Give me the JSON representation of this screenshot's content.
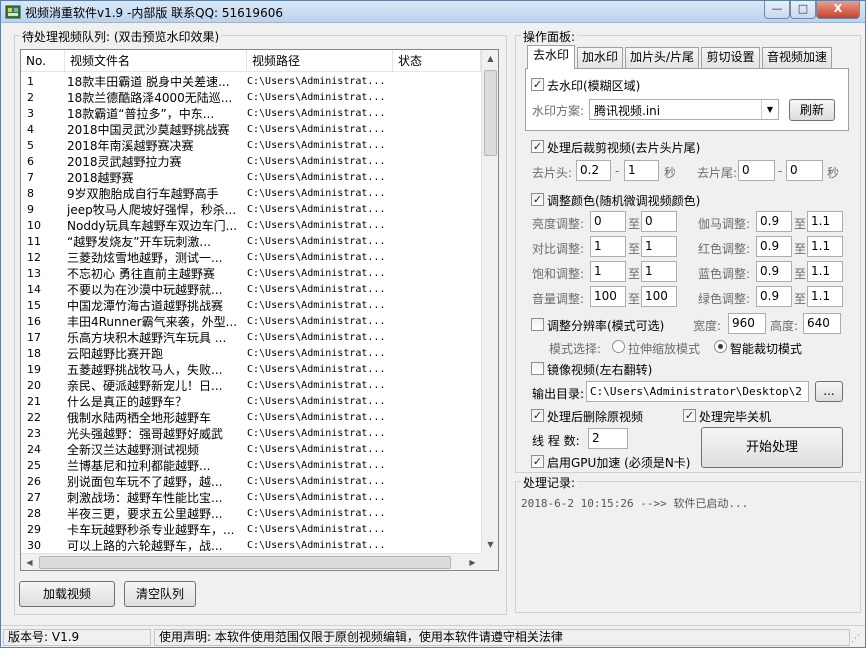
{
  "window": {
    "title": "视频消重软件v1.9 -内部版 联系QQ: 51619606",
    "min_glyph": "—",
    "max_glyph": "□",
    "close_glyph": "X"
  },
  "queue": {
    "group_title": "待处理视频队列: (双击预览水印效果)",
    "columns": [
      "No.",
      "视频文件名",
      "视频路径",
      "状态"
    ],
    "rows": [
      {
        "no": "1",
        "name": "18款丰田霸道 脱身中关差速...",
        "path": "C:\\Users\\Administrat...",
        "status": ""
      },
      {
        "no": "2",
        "name": "18款兰德酷路泽4000无陆巡...",
        "path": "C:\\Users\\Administrat...",
        "status": ""
      },
      {
        "no": "3",
        "name": "18款霸道“普拉多”，中东...",
        "path": "C:\\Users\\Administrat...",
        "status": ""
      },
      {
        "no": "4",
        "name": "2018中国灵武沙莫越野挑战赛",
        "path": "C:\\Users\\Administrat...",
        "status": ""
      },
      {
        "no": "5",
        "name": "2018年南溪越野赛决赛",
        "path": "C:\\Users\\Administrat...",
        "status": ""
      },
      {
        "no": "6",
        "name": "2018灵武越野拉力赛",
        "path": "C:\\Users\\Administrat...",
        "status": ""
      },
      {
        "no": "7",
        "name": "2018越野赛",
        "path": "C:\\Users\\Administrat...",
        "status": ""
      },
      {
        "no": "8",
        "name": "9岁双胞胎成自行车越野高手",
        "path": "C:\\Users\\Administrat...",
        "status": ""
      },
      {
        "no": "9",
        "name": "jeep牧马人爬坡好强悍，秒杀...",
        "path": "C:\\Users\\Administrat...",
        "status": ""
      },
      {
        "no": "10",
        "name": "Noddy玩具车越野车双边车门...",
        "path": "C:\\Users\\Administrat...",
        "status": ""
      },
      {
        "no": "11",
        "name": "“越野发烧友”开车玩刺激...",
        "path": "C:\\Users\\Administrat...",
        "status": ""
      },
      {
        "no": "12",
        "name": "三菱劲炫雪地越野，测试一...",
        "path": "C:\\Users\\Administrat...",
        "status": ""
      },
      {
        "no": "13",
        "name": "不忘初心 勇往直前主越野赛",
        "path": "C:\\Users\\Administrat...",
        "status": ""
      },
      {
        "no": "14",
        "name": "不要以为在沙漠中玩越野就...",
        "path": "C:\\Users\\Administrat...",
        "status": ""
      },
      {
        "no": "15",
        "name": "中国龙潭竹海古道越野挑战赛",
        "path": "C:\\Users\\Administrat...",
        "status": ""
      },
      {
        "no": "16",
        "name": "丰田4Runner霸气来袭，外型...",
        "path": "C:\\Users\\Administrat...",
        "status": ""
      },
      {
        "no": "17",
        "name": "乐高方块积木越野汽车玩具 ...",
        "path": "C:\\Users\\Administrat...",
        "status": ""
      },
      {
        "no": "18",
        "name": "云阳越野比赛开跑",
        "path": "C:\\Users\\Administrat...",
        "status": ""
      },
      {
        "no": "19",
        "name": "五菱越野挑战牧马人，失败...",
        "path": "C:\\Users\\Administrat...",
        "status": ""
      },
      {
        "no": "20",
        "name": "亲民、硬派越野新宠儿！日...",
        "path": "C:\\Users\\Administrat...",
        "status": ""
      },
      {
        "no": "21",
        "name": "什么是真正的越野车？",
        "path": "C:\\Users\\Administrat...",
        "status": ""
      },
      {
        "no": "22",
        "name": "俄制水陆两栖全地形越野车",
        "path": "C:\\Users\\Administrat...",
        "status": ""
      },
      {
        "no": "23",
        "name": "光头强越野：强哥越野好威武",
        "path": "C:\\Users\\Administrat...",
        "status": ""
      },
      {
        "no": "24",
        "name": "全新汉兰达越野测试视频",
        "path": "C:\\Users\\Administrat...",
        "status": ""
      },
      {
        "no": "25",
        "name": "兰博基尼和拉利都能越野...",
        "path": "C:\\Users\\Administrat...",
        "status": ""
      },
      {
        "no": "26",
        "name": "别说面包车玩不了越野，越...",
        "path": "C:\\Users\\Administrat...",
        "status": ""
      },
      {
        "no": "27",
        "name": "刺激战场：越野车性能比宝...",
        "path": "C:\\Users\\Administrat...",
        "status": ""
      },
      {
        "no": "28",
        "name": "半夜三更，要求五公里越野...",
        "path": "C:\\Users\\Administrat...",
        "status": ""
      },
      {
        "no": "29",
        "name": "卡车玩越野秒杀专业越野车，...",
        "path": "C:\\Users\\Administrat...",
        "status": ""
      },
      {
        "no": "30",
        "name": "可以上路的六轮越野车，战...",
        "path": "C:\\Users\\Administrat...",
        "status": ""
      }
    ],
    "load_button": "加载视频",
    "clear_button": "清空队列"
  },
  "panel": {
    "group_title": "操作面板:",
    "tabs": [
      "去水印",
      "加水印",
      "加片头/片尾",
      "剪切设置",
      "音视频加速"
    ],
    "active_tab": "去水印",
    "remove_watermark": {
      "label": "去水印(模糊区域)",
      "checked": true
    },
    "watermark_scheme_label": "水印方案:",
    "watermark_scheme_value": "腾讯视频.ini",
    "refresh_button": "刷新",
    "trim": {
      "label": "处理后裁剪视频(去片头片尾)",
      "checked": true,
      "head_label": "去片头:",
      "head_from": "0.2",
      "head_to": "1",
      "tail_label": "去片尾:",
      "tail_from": "0",
      "tail_to": "0",
      "sep": "-",
      "unit": "秒"
    },
    "color": {
      "label": "调整颜色(随机微调视频颜色)",
      "checked": true,
      "to": "至",
      "left": [
        {
          "label": "亮度调整:",
          "from": "0",
          "to": "0"
        },
        {
          "label": "对比调整:",
          "from": "1",
          "to": "1"
        },
        {
          "label": "饱和调整:",
          "from": "1",
          "to": "1"
        },
        {
          "label": "音量调整:",
          "from": "100",
          "to": "100"
        }
      ],
      "right": [
        {
          "label": "伽马调整:",
          "from": "0.9",
          "to": "1.1"
        },
        {
          "label": "红色调整:",
          "from": "0.9",
          "to": "1.1"
        },
        {
          "label": "蓝色调整:",
          "from": "0.9",
          "to": "1.1"
        },
        {
          "label": "绿色调整:",
          "from": "0.9",
          "to": "1.1"
        }
      ]
    },
    "resolution": {
      "label": "调整分辨率(模式可选)",
      "checked": false,
      "width_label": "宽度:",
      "width": "960",
      "height_label": "高度:",
      "height": "640",
      "mode_label": "模式选择:",
      "mode_stretch": "拉伸缩放模式",
      "mode_crop": "智能裁切模式",
      "selected_mode": "智能裁切模式"
    },
    "mirror": {
      "label": "镜像视频(左右翻转)",
      "checked": false
    },
    "output_label": "输出目录:",
    "output_path": "C:\\Users\\Administrator\\Desktop\\2",
    "browse_button": "...",
    "delete_after": {
      "label": "处理后删除原视频",
      "checked": true
    },
    "shutdown_after": {
      "label": "处理完毕关机",
      "checked": true
    },
    "threads_label": "线 程 数:",
    "threads_value": "2",
    "gpu": {
      "label": "启用GPU加速 (必须是N卡)",
      "checked": true
    },
    "start_button": "开始处理"
  },
  "log": {
    "group_title": "处理记录:",
    "lines": [
      "2018-6-2 10:15:26 -->> 软件已启动..."
    ]
  },
  "status": {
    "version": "版本号: V1.9",
    "notice": "使用声明: 本软件使用范围仅限于原创视频编辑，使用本软件请遵守相关法律"
  }
}
